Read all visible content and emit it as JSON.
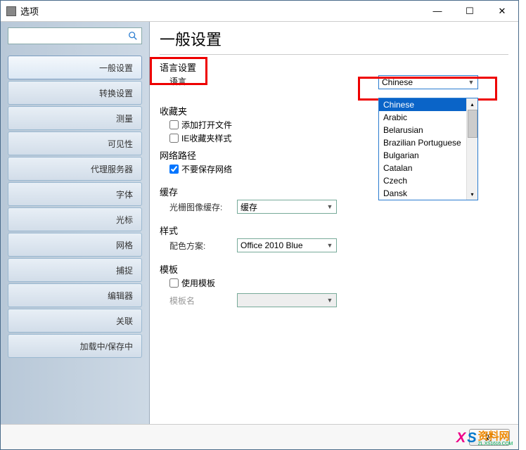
{
  "window": {
    "title": "选项"
  },
  "sidebar": {
    "search": {
      "value": "",
      "placeholder": ""
    },
    "items": [
      {
        "label": "一般设置",
        "active": true
      },
      {
        "label": "转换设置",
        "active": false
      },
      {
        "label": "测量",
        "active": false
      },
      {
        "label": "可见性",
        "active": false
      },
      {
        "label": "代理服务器",
        "active": false
      },
      {
        "label": "字体",
        "active": false
      },
      {
        "label": "光标",
        "active": false
      },
      {
        "label": "网格",
        "active": false
      },
      {
        "label": "捕捉",
        "active": false
      },
      {
        "label": "编辑器",
        "active": false
      },
      {
        "label": "关联",
        "active": false
      },
      {
        "label": "加载中/保存中",
        "active": false
      }
    ]
  },
  "main": {
    "title": "一般设置",
    "sections": {
      "language": {
        "legend": "语言设置",
        "sub": "语言",
        "combo_value": "Chinese",
        "dropdown": {
          "options": [
            "Chinese",
            "Arabic",
            "Belarusian",
            "Brazilian Portuguese",
            "Bulgarian",
            "Catalan",
            "Czech",
            "Dansk"
          ],
          "selected": "Chinese"
        }
      },
      "favorites": {
        "legend": "收藏夹",
        "chk1_label": "添加打开文件",
        "chk1_checked": false,
        "chk2_label": "IE收藏夹样式",
        "chk2_checked": false
      },
      "network": {
        "legend": "网络路径",
        "chk_label": "不要保存网络",
        "chk_checked": true
      },
      "cache": {
        "legend": "缓存",
        "row_label": "光栅图像缓存:",
        "combo_value": "缓存"
      },
      "style": {
        "legend": "样式",
        "row_label": "配色方案:",
        "combo_value": "Office 2010 Blue"
      },
      "template": {
        "legend": "模板",
        "chk_label": "使用模板",
        "chk_checked": false,
        "row_label": "模板名",
        "combo_value": ""
      }
    }
  },
  "footer": {
    "ok": "好"
  },
  "watermark": {
    "x": "X",
    "s": "S",
    "text": "资料网",
    "url": "ZL.XS1616.COM"
  }
}
